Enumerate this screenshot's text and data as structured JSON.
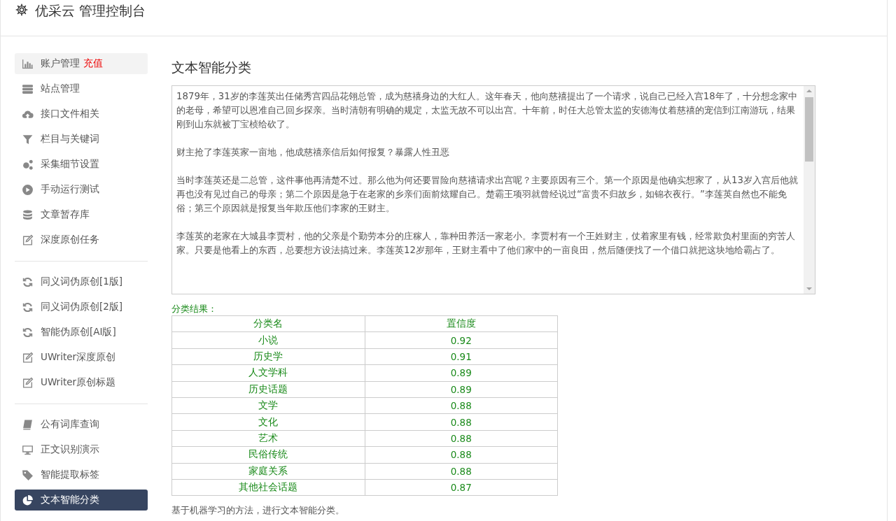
{
  "header": {
    "title": "优采云 管理控制台"
  },
  "sidebar": {
    "groups": [
      {
        "items": [
          {
            "label": "账户管理",
            "badge": "充值",
            "highlighted": true,
            "selected": false
          },
          {
            "label": "站点管理",
            "highlighted": false,
            "selected": false
          },
          {
            "label": "接口文件相关",
            "highlighted": false,
            "selected": false
          },
          {
            "label": "栏目与关键词",
            "highlighted": false,
            "selected": false
          },
          {
            "label": "采集细节设置",
            "highlighted": false,
            "selected": false
          },
          {
            "label": "手动运行测试",
            "highlighted": false,
            "selected": false
          },
          {
            "label": "文章暂存库",
            "highlighted": false,
            "selected": false
          },
          {
            "label": "深度原创任务",
            "highlighted": false,
            "selected": false
          }
        ]
      },
      {
        "items": [
          {
            "label": "同义词伪原创[1版]",
            "highlighted": false,
            "selected": false
          },
          {
            "label": "同义词伪原创[2版]",
            "highlighted": false,
            "selected": false
          },
          {
            "label": "智能伪原创[AI版]",
            "highlighted": false,
            "selected": false
          },
          {
            "label": "UWriter深度原创",
            "highlighted": false,
            "selected": false
          },
          {
            "label": "UWriter原创标题",
            "highlighted": false,
            "selected": false
          }
        ]
      },
      {
        "items": [
          {
            "label": "公有词库查询",
            "highlighted": false,
            "selected": false
          },
          {
            "label": "正文识别演示",
            "highlighted": false,
            "selected": false
          },
          {
            "label": "智能提取标签",
            "highlighted": false,
            "selected": false
          },
          {
            "label": "文本智能分类",
            "highlighted": false,
            "selected": true
          }
        ]
      }
    ]
  },
  "main": {
    "title": "文本智能分类",
    "text_input": {
      "paragraphs": [
        "1879年，31岁的李莲英出任储秀宫四品花翎总管，成为慈禧身边的大红人。这年春天，他向慈禧提出了一个请求，说自己已经入宫18年了，十分想念家中的老母，希望可以恩准自己回乡探亲。当时清朝有明确的规定，太监无故不可以出宫。十年前，时任大总管太监的安德海仗着慈禧的宠信到江南游玩，结果刚到山东就被丁宝桢给砍了。",
        "财主抢了李莲英家一亩地，他成慈禧亲信后如何报复？暴露人性丑恶",
        "当时李莲英还是二总管，这件事他再清楚不过。那么他为何还要冒险向慈禧请求出宫呢？主要原因有三个。第一个原因是他确实想家了，从13岁入宫后他就再也没有见过自己的母亲；第二个原因是急于在老家的乡亲们面前炫耀自己。楚霸王项羽就曾经说过“富贵不归故乡，如锦衣夜行。”李莲英自然也不能免俗；第三个原因就是报复当年欺压他们李家的王财主。",
        "李莲英的老家在大城县李贾村，他的父亲是个勤劳本分的庄稼人，靠种田养活一家老小。李贾村有一个王姓财主，仗着家里有钱，经常欺负村里面的穷苦人家。只要是他看上的东西，总要想方设法搞过来。李莲英12岁那年，王财主看中了他们家中的一亩良田，然后随便找了一个借口就把这块地给霸占了。"
      ]
    },
    "result_label": "分类结果：",
    "table": {
      "columns": [
        "分类名",
        "置信度"
      ],
      "rows": [
        [
          "小说",
          "0.92"
        ],
        [
          "历史学",
          "0.91"
        ],
        [
          "人文学科",
          "0.89"
        ],
        [
          "历史话题",
          "0.89"
        ],
        [
          "文学",
          "0.88"
        ],
        [
          "文化",
          "0.88"
        ],
        [
          "艺术",
          "0.88"
        ],
        [
          "民俗传统",
          "0.88"
        ],
        [
          "家庭关系",
          "0.88"
        ],
        [
          "其他社会话题",
          "0.87"
        ]
      ]
    },
    "note": "基于机器学习的方法，进行文本智能分类。"
  }
}
